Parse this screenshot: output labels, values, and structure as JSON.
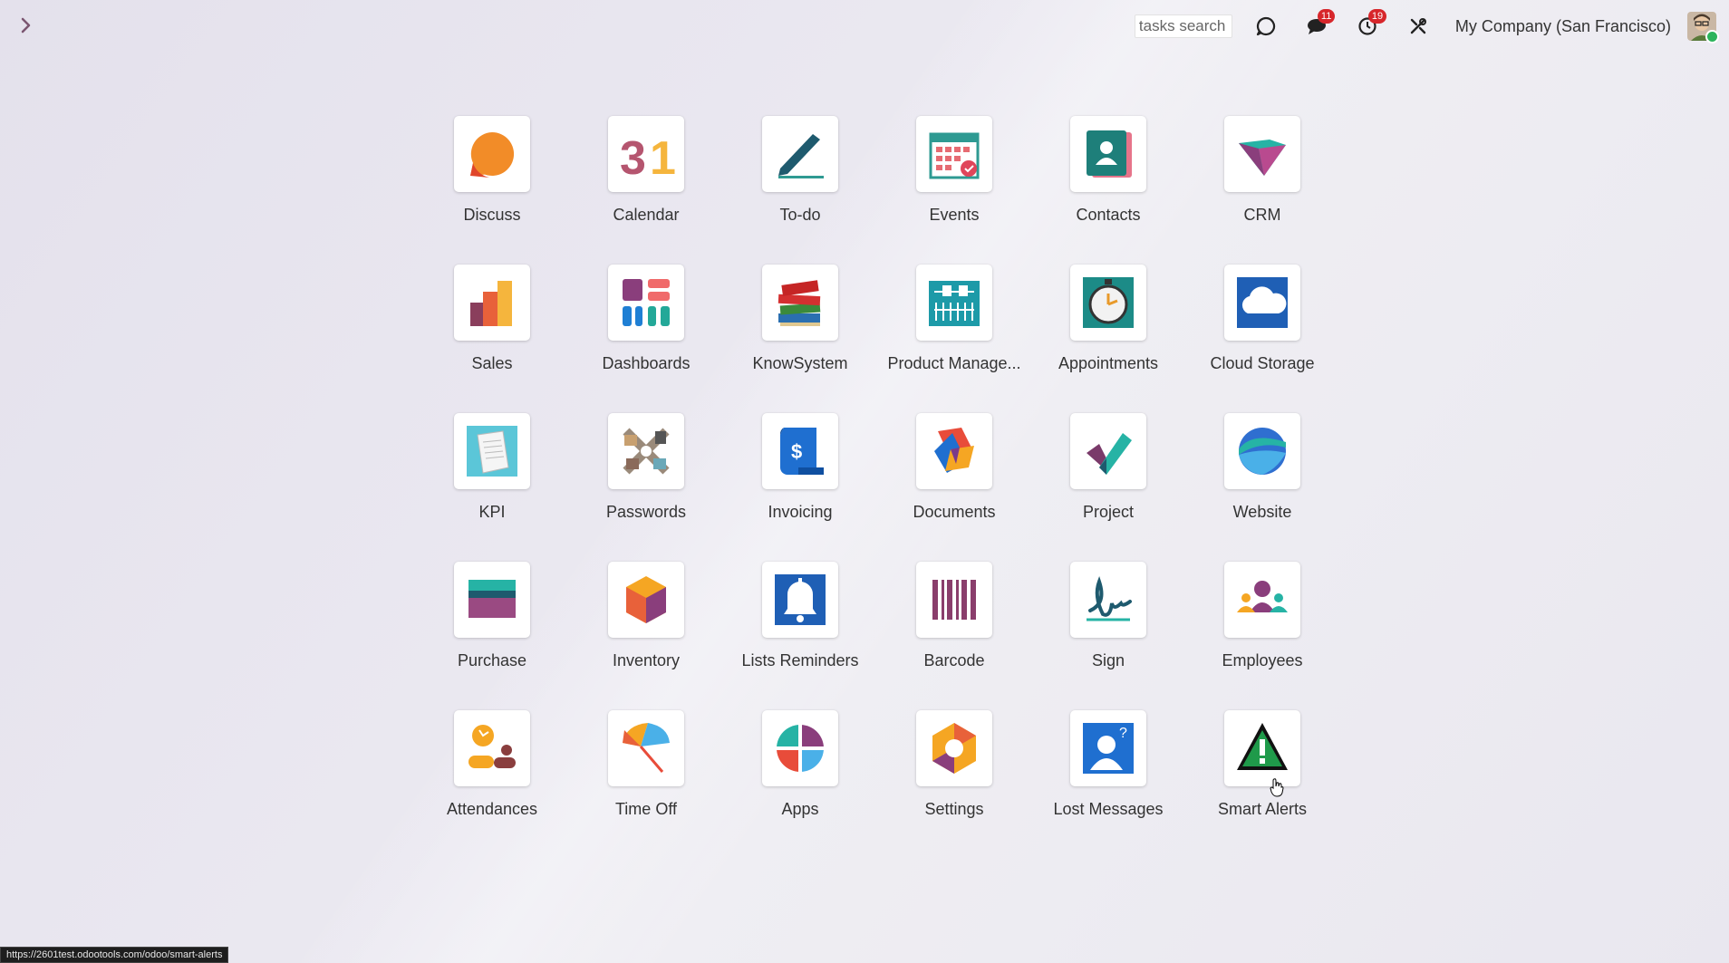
{
  "topbar": {
    "search_placeholder": "tasks search",
    "messages_count": "11",
    "activities_count": "19",
    "company_name": "My Company (San Francisco)"
  },
  "apps": [
    {
      "label": "Discuss",
      "icon": "discuss-icon"
    },
    {
      "label": "Calendar",
      "icon": "calendar-icon"
    },
    {
      "label": "To-do",
      "icon": "todo-icon"
    },
    {
      "label": "Events",
      "icon": "events-icon"
    },
    {
      "label": "Contacts",
      "icon": "contacts-icon"
    },
    {
      "label": "CRM",
      "icon": "crm-icon"
    },
    {
      "label": "Sales",
      "icon": "sales-icon"
    },
    {
      "label": "Dashboards",
      "icon": "dashboards-icon"
    },
    {
      "label": "KnowSystem",
      "icon": "knowsystem-icon"
    },
    {
      "label": "Product Manage...",
      "icon": "product-management-icon"
    },
    {
      "label": "Appointments",
      "icon": "appointments-icon"
    },
    {
      "label": "Cloud Storage",
      "icon": "cloud-storage-icon"
    },
    {
      "label": "KPI",
      "icon": "kpi-icon"
    },
    {
      "label": "Passwords",
      "icon": "passwords-icon"
    },
    {
      "label": "Invoicing",
      "icon": "invoicing-icon"
    },
    {
      "label": "Documents",
      "icon": "documents-icon"
    },
    {
      "label": "Project",
      "icon": "project-icon"
    },
    {
      "label": "Website",
      "icon": "website-icon"
    },
    {
      "label": "Purchase",
      "icon": "purchase-icon"
    },
    {
      "label": "Inventory",
      "icon": "inventory-icon"
    },
    {
      "label": "Lists Reminders",
      "icon": "lists-reminders-icon"
    },
    {
      "label": "Barcode",
      "icon": "barcode-icon"
    },
    {
      "label": "Sign",
      "icon": "sign-icon"
    },
    {
      "label": "Employees",
      "icon": "employees-icon"
    },
    {
      "label": "Attendances",
      "icon": "attendances-icon"
    },
    {
      "label": "Time Off",
      "icon": "time-off-icon"
    },
    {
      "label": "Apps",
      "icon": "apps-icon"
    },
    {
      "label": "Settings",
      "icon": "settings-icon"
    },
    {
      "label": "Lost Messages",
      "icon": "lost-messages-icon"
    },
    {
      "label": "Smart Alerts",
      "icon": "smart-alerts-icon"
    }
  ],
  "status_bar": {
    "url": "https://2601test.odootools.com/odoo/smart-alerts"
  },
  "colors": {
    "accent": "#714b67",
    "badge": "#d7262b"
  }
}
